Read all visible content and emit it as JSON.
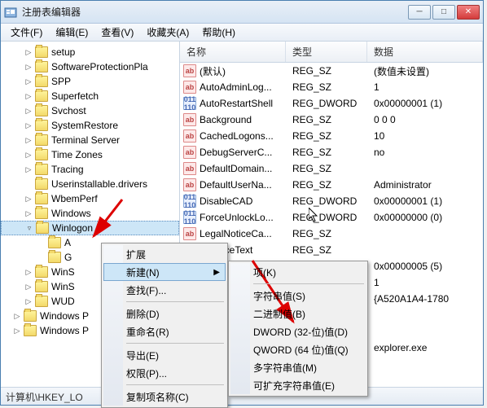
{
  "window": {
    "title": "注册表编辑器"
  },
  "menu": {
    "file": "文件(F)",
    "edit": "编辑(E)",
    "view": "查看(V)",
    "fav": "收藏夹(A)",
    "help": "帮助(H)"
  },
  "tree": [
    {
      "label": "setup",
      "indent": 28,
      "expand": "▷"
    },
    {
      "label": "SoftwareProtectionPla",
      "indent": 28,
      "expand": "▷"
    },
    {
      "label": "SPP",
      "indent": 28,
      "expand": "▷"
    },
    {
      "label": "Superfetch",
      "indent": 28,
      "expand": "▷"
    },
    {
      "label": "Svchost",
      "indent": 28,
      "expand": "▷"
    },
    {
      "label": "SystemRestore",
      "indent": 28,
      "expand": "▷"
    },
    {
      "label": "Terminal Server",
      "indent": 28,
      "expand": "▷"
    },
    {
      "label": "Time Zones",
      "indent": 28,
      "expand": "▷"
    },
    {
      "label": "Tracing",
      "indent": 28,
      "expand": "▷"
    },
    {
      "label": "Userinstallable.drivers",
      "indent": 28,
      "expand": ""
    },
    {
      "label": "WbemPerf",
      "indent": 28,
      "expand": "▷"
    },
    {
      "label": "Windows",
      "indent": 28,
      "expand": "▷"
    },
    {
      "label": "Winlogon",
      "indent": 28,
      "expand": "▿",
      "selected": true
    },
    {
      "label": "A",
      "indent": 44,
      "expand": ""
    },
    {
      "label": "G",
      "indent": 44,
      "expand": ""
    },
    {
      "label": "WinS",
      "indent": 28,
      "expand": "▷"
    },
    {
      "label": "WinS",
      "indent": 28,
      "expand": "▷"
    },
    {
      "label": "WUD",
      "indent": 28,
      "expand": "▷"
    },
    {
      "label": "Windows P",
      "indent": 14,
      "expand": "▷"
    },
    {
      "label": "Windows P",
      "indent": 14,
      "expand": "▷"
    }
  ],
  "listHeader": {
    "name": "名称",
    "type": "类型",
    "data": "数据"
  },
  "rows": [
    {
      "icon": "str",
      "name": "(默认)",
      "type": "REG_SZ",
      "data": "(数值未设置)"
    },
    {
      "icon": "str",
      "name": "AutoAdminLog...",
      "type": "REG_SZ",
      "data": "1"
    },
    {
      "icon": "bin",
      "name": "AutoRestartShell",
      "type": "REG_DWORD",
      "data": "0x00000001 (1)"
    },
    {
      "icon": "str",
      "name": "Background",
      "type": "REG_SZ",
      "data": "0 0 0"
    },
    {
      "icon": "str",
      "name": "CachedLogons...",
      "type": "REG_SZ",
      "data": "10"
    },
    {
      "icon": "str",
      "name": "DebugServerC...",
      "type": "REG_SZ",
      "data": "no"
    },
    {
      "icon": "str",
      "name": "DefaultDomain...",
      "type": "REG_SZ",
      "data": ""
    },
    {
      "icon": "str",
      "name": "DefaultUserNa...",
      "type": "REG_SZ",
      "data": "Administrator"
    },
    {
      "icon": "bin",
      "name": "DisableCAD",
      "type": "REG_DWORD",
      "data": "0x00000001 (1)"
    },
    {
      "icon": "bin",
      "name": "ForceUnlockLo...",
      "type": "REG_DWORD",
      "data": "0x00000000 (0)"
    },
    {
      "icon": "str",
      "name": "LegalNoticeCa...",
      "type": "REG_SZ",
      "data": ""
    },
    {
      "icon": "str",
      "name": "alNoticeText",
      "type": "REG_SZ",
      "data": ""
    },
    {
      "icon": "",
      "name": "",
      "type": "",
      "data": "0x00000005 (5)"
    },
    {
      "icon": "",
      "name": "",
      "type": "",
      "data": "1"
    },
    {
      "icon": "",
      "name": "",
      "type": "",
      "data": "{A520A1A4-1780"
    },
    {
      "icon": "",
      "name": "",
      "type": "",
      "data": ""
    },
    {
      "icon": "",
      "name": "",
      "type": "",
      "data": ""
    },
    {
      "icon": "",
      "name": "",
      "type": "",
      "data": "explorer.exe"
    }
  ],
  "ctx1": {
    "expand": "扩展",
    "new": "新建(N)",
    "find": "查找(F)...",
    "delete": "删除(D)",
    "rename": "重命名(R)",
    "export": "导出(E)",
    "perm": "权限(P)...",
    "copyname": "复制项名称(C)"
  },
  "ctx2": {
    "key": "项(K)",
    "string": "字符串值(S)",
    "binary": "二进制值(B)",
    "dword": "DWORD (32-位)值(D)",
    "qword": "QWORD (64 位)值(Q)",
    "multi": "多字符串值(M)",
    "expand": "可扩充字符串值(E)"
  },
  "status": "计算机\\HKEY_LO"
}
